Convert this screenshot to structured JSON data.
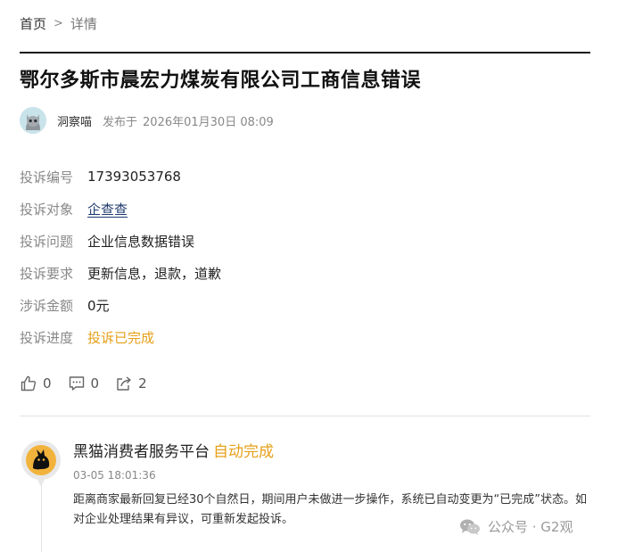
{
  "breadcrumb": {
    "home": "首页",
    "separator": ">",
    "current": "详情"
  },
  "title": "鄂尔多斯市晨宏力煤炭有限公司工商信息错误",
  "author": {
    "name": "洞察喵",
    "publish_label": "发布于",
    "publish_time": "2026年01月30日 08:09",
    "avatar_icon": "cat-avatar-icon"
  },
  "details": [
    {
      "label": "投诉编号",
      "value": "17393053768",
      "style": "plain"
    },
    {
      "label": "投诉对象",
      "value": "企查查",
      "style": "link"
    },
    {
      "label": "投诉问题",
      "value": "企业信息数据错误",
      "style": "plain"
    },
    {
      "label": "投诉要求",
      "value": "更新信息，退款，道歉",
      "style": "plain"
    },
    {
      "label": "涉诉金额",
      "value": "0元",
      "style": "plain"
    },
    {
      "label": "投诉进度",
      "value": "投诉已完成",
      "style": "status"
    }
  ],
  "actions": {
    "like_count": "0",
    "comment_count": "0",
    "share_count": "2"
  },
  "reply": {
    "org": "黑猫消费者服务平台",
    "status": "自动完成",
    "time": "03-05 18:01:36",
    "body": "距离商家最新回复已经30个自然日，期间用户未做进一步操作，系统已自动变更为“已完成”状态。如对企业处理结果有异议，可重新发起投诉。",
    "avatar_icon": "black-cat-logo-icon"
  },
  "watermark": {
    "text": "公众号 · G2观",
    "icon": "wechat-icon"
  },
  "colors": {
    "accent_orange": "#e6a01a",
    "link_navy": "#1f3a6e",
    "label_gray": "#888888",
    "rule_dark": "#1a1a1a"
  }
}
